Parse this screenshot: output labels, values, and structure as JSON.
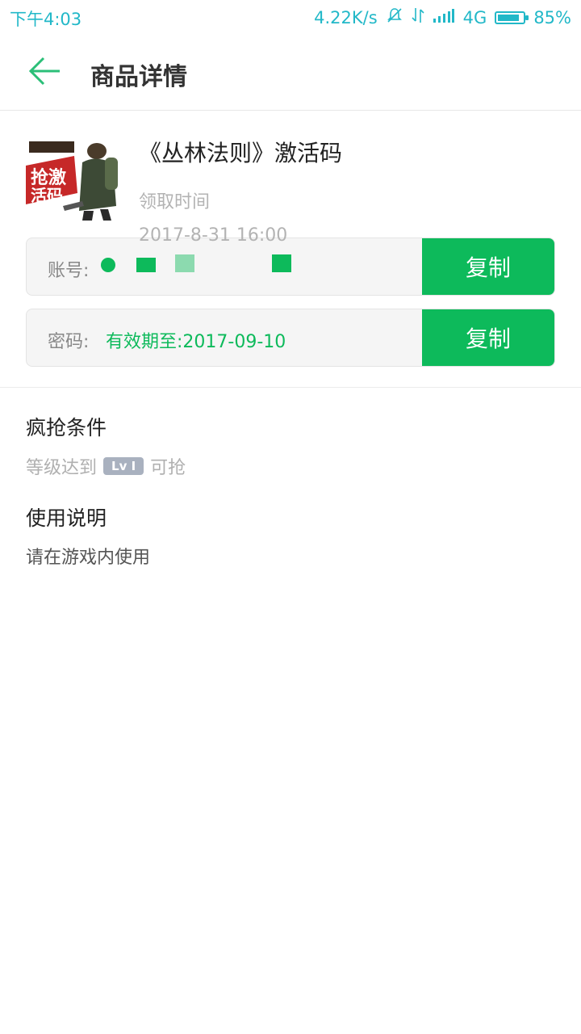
{
  "status_bar": {
    "time": "下午4:03",
    "speed": "4.22K/s",
    "network": "4G",
    "battery_percent": "85%",
    "battery_level": 0.85,
    "color": "#22b8c8"
  },
  "header": {
    "title": "商品详情",
    "back_icon": "arrow-left-icon",
    "accent": "#2bbf78"
  },
  "product": {
    "name": "《丛林法则》激活码",
    "claim_label": "领取时间",
    "claim_time": "2017-8-31 16:00",
    "image_text": "抢激活码"
  },
  "account_row": {
    "label": "账号:",
    "copy_label": "复制"
  },
  "password_row": {
    "label": "密码:",
    "value": "有效期至:2017-09-10",
    "copy_label": "复制"
  },
  "conditions": {
    "title": "疯抢条件",
    "prefix": "等级达到",
    "badge": "Lv I",
    "suffix": "可抢"
  },
  "usage": {
    "title": "使用说明",
    "text": "请在游戏内使用"
  },
  "colors": {
    "primary_green": "#0dba5b",
    "muted_text": "#b3b3b3"
  }
}
